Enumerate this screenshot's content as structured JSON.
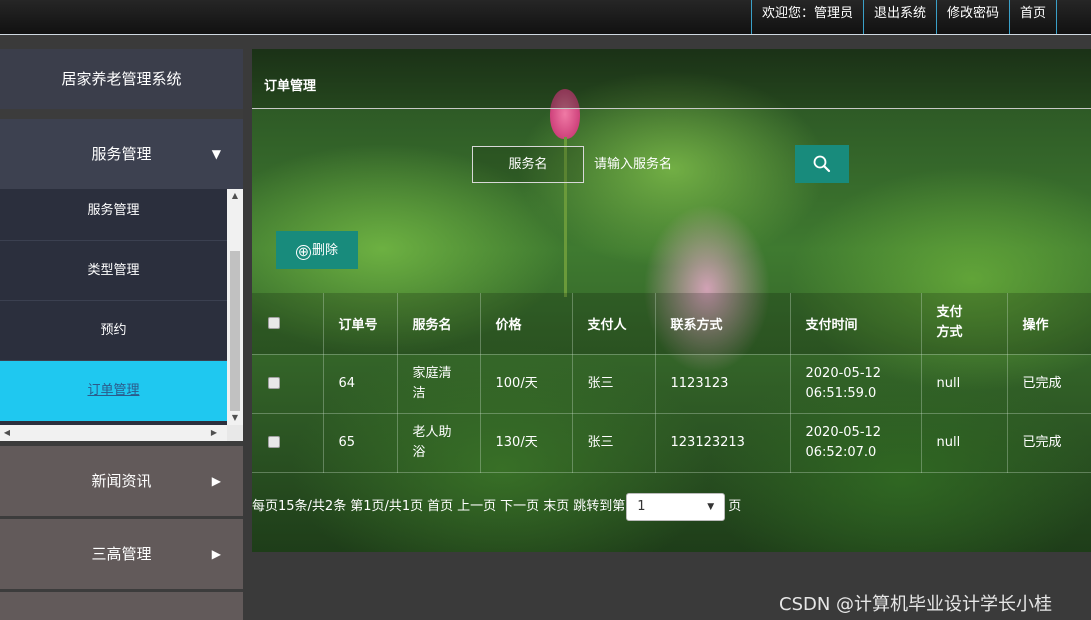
{
  "topnav": {
    "welcome": "欢迎您：管理员",
    "logout": "退出系统",
    "change_password": "修改密码",
    "home": "首页"
  },
  "sidebar": {
    "system_title": "居家养老管理系统",
    "groups": [
      {
        "label": "服务管理",
        "expanded": true,
        "items": [
          {
            "label": "服务管理"
          },
          {
            "label": "类型管理"
          },
          {
            "label": "预约"
          },
          {
            "label": "订单管理",
            "active": true
          }
        ]
      },
      {
        "label": "新闻资讯",
        "expanded": false
      },
      {
        "label": "三高管理",
        "expanded": false
      }
    ],
    "arrow_down": "▼",
    "arrow_right": "▶",
    "scroll_up": "▲",
    "scroll_down": "▼",
    "scroll_left": "◀",
    "scroll_right": "▶"
  },
  "main": {
    "title": "订单管理",
    "search": {
      "label": "服务名",
      "placeholder": "请输入服务名",
      "value": ""
    },
    "delete_label": "删除",
    "delete_icon": "⊕",
    "table": {
      "headers": [
        "订单号",
        "服务名",
        "价格",
        "支付人",
        "联系方式",
        "支付时间",
        "支付方式",
        "操作"
      ],
      "rows": [
        {
          "order_no": "64",
          "service": "家庭清洁",
          "price": "100/天",
          "payer": "张三",
          "contact": "1123123",
          "pay_time": "2020-05-12 06:51:59.0",
          "pay_method": "null",
          "action": "已完成"
        },
        {
          "order_no": "65",
          "service": "老人助浴",
          "price": "130/天",
          "payer": "张三",
          "contact": "123123213",
          "pay_time": "2020-05-12 06:52:07.0",
          "pay_method": "null",
          "action": "已完成"
        }
      ]
    },
    "pager": {
      "summary": "每页15条/共2条",
      "page_info": "第1页/共1页",
      "first": "首页",
      "prev": "上一页",
      "next": "下一页",
      "last": "末页",
      "jump_to": "跳转到第",
      "selected_page": "1",
      "page_suffix": "页"
    }
  },
  "watermark": "CSDN @计算机毕业设计学长小桂",
  "colors": {
    "accent_teal": "#188b7c",
    "active_menu": "#1fc8f0",
    "topbar_divider": "#3aa0c8"
  }
}
